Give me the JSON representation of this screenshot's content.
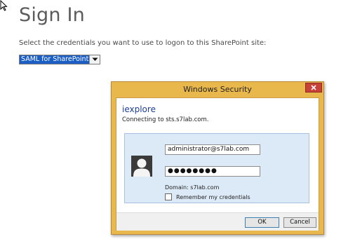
{
  "page": {
    "title": "Sign In",
    "instruction": "Select the credentials you want to use to logon to this SharePoint site:",
    "credential_select": {
      "value": "SAML for SharePoint"
    }
  },
  "dialog": {
    "title": "Windows Security",
    "close_icon": "close-icon",
    "app_name": "iexplore",
    "connecting_text": "Connecting to sts.s7lab.com.",
    "username_value": "administrator@s7lab.com",
    "password_value": "●●●●●●●●",
    "domain_text": "Domain: s7lab.com",
    "remember_label": "Remember my credentials",
    "remember_checked": false,
    "ok_label": "OK",
    "cancel_label": "Cancel",
    "avatar_icon": "user-avatar-icon"
  },
  "colors": {
    "title_bar": "#e9b84c",
    "close_button": "#c8403a",
    "credential_panel": "#dce9f7",
    "select_highlight": "#1b5fc4",
    "app_name": "#1c3f95"
  }
}
